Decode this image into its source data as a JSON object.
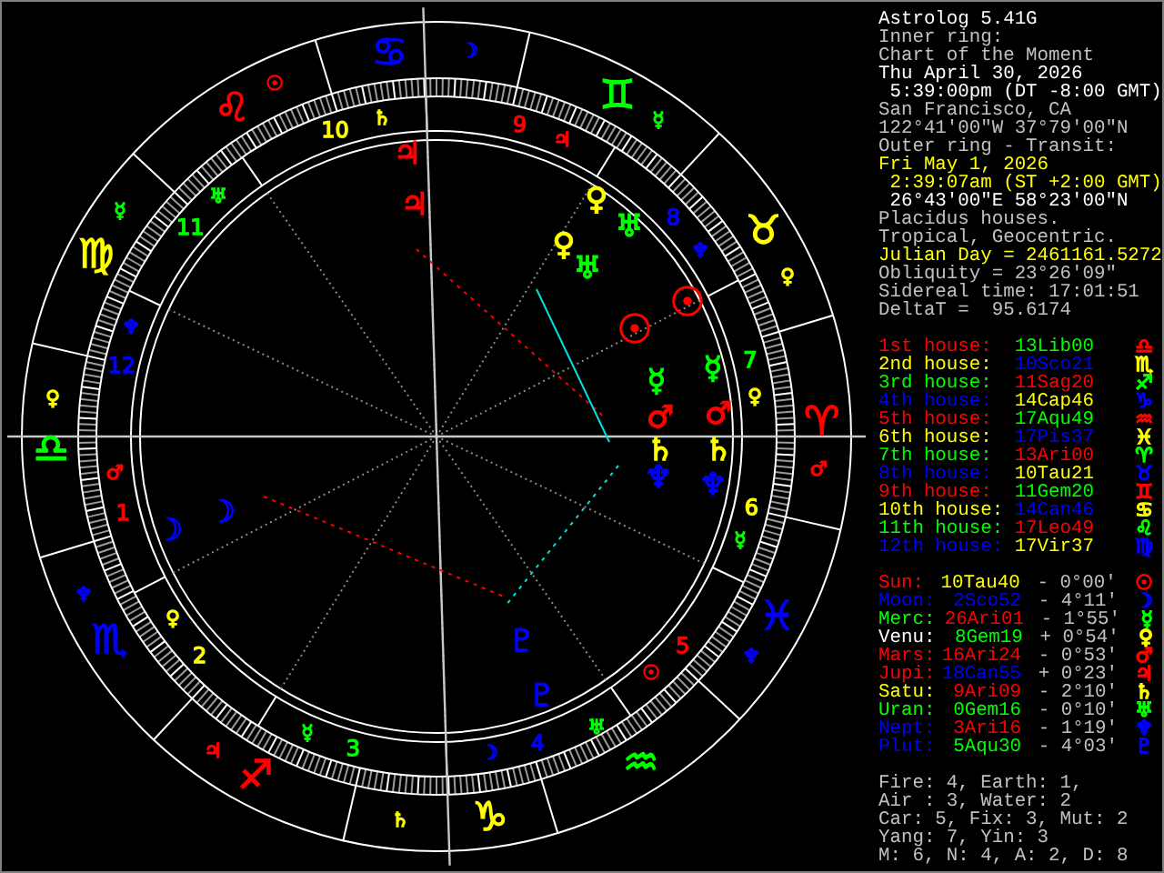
{
  "chart": {
    "signs": [
      {
        "glyph": "♈",
        "color": "#ff0000"
      },
      {
        "glyph": "♉",
        "color": "#ffff00"
      },
      {
        "glyph": "♊",
        "color": "#00ff00"
      },
      {
        "glyph": "♋",
        "color": "#0000ff"
      },
      {
        "glyph": "♌",
        "color": "#ff0000"
      },
      {
        "glyph": "♍",
        "color": "#ffff00"
      },
      {
        "glyph": "♎",
        "color": "#00ff00"
      },
      {
        "glyph": "♏",
        "color": "#0000ff"
      },
      {
        "glyph": "♐",
        "color": "#ff0000"
      },
      {
        "glyph": "♑",
        "color": "#ffff00"
      },
      {
        "glyph": "♒",
        "color": "#00ff00"
      },
      {
        "glyph": "♓",
        "color": "#0000ff"
      }
    ],
    "house_numbers": [
      {
        "text": "1",
        "color": "#ff0000"
      },
      {
        "text": "2",
        "color": "#ffff00"
      },
      {
        "text": "3",
        "color": "#00ff00"
      },
      {
        "text": "4",
        "color": "#0000ff"
      },
      {
        "text": "5",
        "color": "#ff0000"
      },
      {
        "text": "6",
        "color": "#ffff00"
      },
      {
        "text": "7",
        "color": "#00ff00"
      },
      {
        "text": "8",
        "color": "#0000ff"
      },
      {
        "text": "9",
        "color": "#ff0000"
      },
      {
        "text": "10",
        "color": "#ffff00"
      },
      {
        "text": "11",
        "color": "#00ff00"
      },
      {
        "text": "12",
        "color": "#0000ff"
      }
    ],
    "inner_planets": [
      {
        "glyph": "♃",
        "color": "#ff0000"
      },
      {
        "glyph": "♀",
        "color": "#ffff00"
      },
      {
        "glyph": "♅",
        "color": "#00ff00"
      },
      {
        "glyph": "☉",
        "color": "#ff0000"
      },
      {
        "glyph": "☿",
        "color": "#00ff00"
      },
      {
        "glyph": "♂",
        "color": "#ff0000"
      },
      {
        "glyph": "♄",
        "color": "#ffff00"
      },
      {
        "glyph": "♆",
        "color": "#0000ff"
      },
      {
        "glyph": "☽",
        "color": "#0000ff"
      },
      {
        "glyph": "♇",
        "color": "#0000ff"
      }
    ],
    "outer_planets": [
      {
        "glyph": "♃",
        "color": "#ff0000"
      },
      {
        "glyph": "♀",
        "color": "#ffff00"
      },
      {
        "glyph": "♅",
        "color": "#00ff00"
      },
      {
        "glyph": "☉",
        "color": "#ff0000"
      },
      {
        "glyph": "☿",
        "color": "#00ff00"
      },
      {
        "glyph": "♂",
        "color": "#ff0000"
      },
      {
        "glyph": "♄",
        "color": "#ffff00"
      },
      {
        "glyph": "♆",
        "color": "#0000ff"
      },
      {
        "glyph": "☽",
        "color": "#0000ff"
      },
      {
        "glyph": "♇",
        "color": "#0000ff"
      }
    ],
    "ring_glyphs": [
      {
        "glyph": "☽",
        "color": "#0000ff"
      },
      {
        "glyph": "☉",
        "color": "#ff0000"
      },
      {
        "glyph": "♄",
        "color": "#ffff00"
      },
      {
        "glyph": "☿",
        "color": "#00ff00"
      },
      {
        "glyph": "♃",
        "color": "#ff0000"
      },
      {
        "glyph": "♅",
        "color": "#00ff00"
      },
      {
        "glyph": "☿",
        "color": "#00ff00"
      },
      {
        "glyph": "♆",
        "color": "#0000ff"
      },
      {
        "glyph": "♀",
        "color": "#ffff00"
      },
      {
        "glyph": "♆",
        "color": "#0000ff"
      },
      {
        "glyph": "♀",
        "color": "#ffff00"
      },
      {
        "glyph": "♀",
        "color": "#ffff00"
      },
      {
        "glyph": "♂",
        "color": "#ff0000"
      },
      {
        "glyph": "♂",
        "color": "#ff0000"
      },
      {
        "glyph": "☿",
        "color": "#00ff00"
      },
      {
        "glyph": "♆",
        "color": "#0000ff"
      },
      {
        "glyph": "♀",
        "color": "#ffff00"
      },
      {
        "glyph": "♆",
        "color": "#0000ff"
      },
      {
        "glyph": "☉",
        "color": "#ff0000"
      },
      {
        "glyph": "☿",
        "color": "#00ff00"
      },
      {
        "glyph": "♅",
        "color": "#00ff00"
      },
      {
        "glyph": "♃",
        "color": "#ff0000"
      },
      {
        "glyph": "☽",
        "color": "#0000ff"
      },
      {
        "glyph": "♄",
        "color": "#ffff00"
      }
    ]
  },
  "info_lines": [
    {
      "text": "Astrolog 5.41G",
      "color": "#ffffff"
    },
    {
      "text": "Inner ring:",
      "color": "#c0c0c0"
    },
    {
      "text": "Chart of the Moment",
      "color": "#c0c0c0"
    },
    {
      "text": "Thu April 30, 2026",
      "color": "#ffffff"
    },
    {
      "text": " 5:39:00pm (DT -8:00 GMT)",
      "color": "#ffffff"
    },
    {
      "text": "San Francisco, CA",
      "color": "#c0c0c0"
    },
    {
      "text": "122°41'00\"W 37°79'00\"N",
      "color": "#c0c0c0"
    },
    {
      "text": "Outer ring - Transit:",
      "color": "#c0c0c0"
    },
    {
      "text": "Fri May 1, 2026",
      "color": "#ffff00"
    },
    {
      "text": " 2:39:07am (ST +2:00 GMT)",
      "color": "#ffff00"
    },
    {
      "text": " 26°43'00\"E 58°23'00\"N",
      "color": "#ffffff"
    },
    {
      "text": "Placidus houses.",
      "color": "#c0c0c0"
    },
    {
      "text": "Tropical, Geocentric.",
      "color": "#c0c0c0"
    },
    {
      "text": "Julian Day = 2461161.5272",
      "color": "#ffff00"
    },
    {
      "text": "Obliquity = 23°26'09\"",
      "color": "#c0c0c0"
    },
    {
      "text": "Sidereal time: 17:01:51",
      "color": "#c0c0c0"
    },
    {
      "text": "DeltaT =  95.6174",
      "color": "#c0c0c0"
    }
  ],
  "houses": [
    {
      "label": {
        "text": "1st house:",
        "color": "#ff0000"
      },
      "position": {
        "text": "13Lib00",
        "color": "#00ff00"
      },
      "glyph": {
        "text": "♎",
        "color": "#ff0000"
      }
    },
    {
      "label": {
        "text": "2nd house:",
        "color": "#ffff00"
      },
      "position": {
        "text": "10Sco21",
        "color": "#0000ff"
      },
      "glyph": {
        "text": "♏",
        "color": "#ffff00"
      }
    },
    {
      "label": {
        "text": "3rd house:",
        "color": "#00ff00"
      },
      "position": {
        "text": "11Sag20",
        "color": "#ff0000"
      },
      "glyph": {
        "text": "♐",
        "color": "#00ff00"
      }
    },
    {
      "label": {
        "text": "4th house:",
        "color": "#0000ff"
      },
      "position": {
        "text": "14Cap46",
        "color": "#ffff00"
      },
      "glyph": {
        "text": "♑",
        "color": "#0000ff"
      }
    },
    {
      "label": {
        "text": "5th house:",
        "color": "#ff0000"
      },
      "position": {
        "text": "17Aqu49",
        "color": "#00ff00"
      },
      "glyph": {
        "text": "♒",
        "color": "#ff0000"
      }
    },
    {
      "label": {
        "text": "6th house:",
        "color": "#ffff00"
      },
      "position": {
        "text": "17Pis37",
        "color": "#0000ff"
      },
      "glyph": {
        "text": "♓",
        "color": "#ffff00"
      }
    },
    {
      "label": {
        "text": "7th house:",
        "color": "#00ff00"
      },
      "position": {
        "text": "13Ari00",
        "color": "#ff0000"
      },
      "glyph": {
        "text": "♈",
        "color": "#00ff00"
      }
    },
    {
      "label": {
        "text": "8th house:",
        "color": "#0000ff"
      },
      "position": {
        "text": "10Tau21",
        "color": "#ffff00"
      },
      "glyph": {
        "text": "♉",
        "color": "#0000ff"
      }
    },
    {
      "label": {
        "text": "9th house:",
        "color": "#ff0000"
      },
      "position": {
        "text": "11Gem20",
        "color": "#00ff00"
      },
      "glyph": {
        "text": "♊",
        "color": "#ff0000"
      }
    },
    {
      "label": {
        "text": "10th house:",
        "color": "#ffff00"
      },
      "position": {
        "text": "14Can46",
        "color": "#0000ff"
      },
      "glyph": {
        "text": "♋",
        "color": "#ffff00"
      }
    },
    {
      "label": {
        "text": "11th house:",
        "color": "#00ff00"
      },
      "position": {
        "text": "17Leo49",
        "color": "#ff0000"
      },
      "glyph": {
        "text": "♌",
        "color": "#00ff00"
      }
    },
    {
      "label": {
        "text": "12th house:",
        "color": "#0000ff"
      },
      "position": {
        "text": "17Vir37",
        "color": "#ffff00"
      },
      "glyph": {
        "text": "♍",
        "color": "#0000ff"
      }
    }
  ],
  "planets": [
    {
      "label": {
        "text": "Sun:",
        "color": "#ff0000"
      },
      "position": {
        "text": "10Tau40",
        "color": "#ffff00"
      },
      "aspect": "- 0°00'",
      "glyph": {
        "text": "☉",
        "color": "#ff0000"
      }
    },
    {
      "label": {
        "text": "Moon:",
        "color": "#0000ff"
      },
      "position": {
        "text": "2Sco52",
        "color": "#0000ff"
      },
      "aspect": "- 4°11'",
      "glyph": {
        "text": "☽",
        "color": "#0000ff"
      }
    },
    {
      "label": {
        "text": "Merc:",
        "color": "#00ff00"
      },
      "position": {
        "text": "26Ari01",
        "color": "#ff0000"
      },
      "aspect": "- 1°55'",
      "glyph": {
        "text": "☿",
        "color": "#00ff00"
      }
    },
    {
      "label": {
        "text": "Venu:",
        "color": "#ffffff"
      },
      "position": {
        "text": "8Gem19",
        "color": "#00ff00"
      },
      "aspect": "+ 0°54'",
      "glyph": {
        "text": "♀",
        "color": "#ffff00"
      }
    },
    {
      "label": {
        "text": "Mars:",
        "color": "#ff0000"
      },
      "position": {
        "text": "16Ari24",
        "color": "#ff0000"
      },
      "aspect": "- 0°53'",
      "glyph": {
        "text": "♂",
        "color": "#ff0000"
      }
    },
    {
      "label": {
        "text": "Jupi:",
        "color": "#ff0000"
      },
      "position": {
        "text": "18Can55",
        "color": "#0000ff"
      },
      "aspect": "+ 0°23'",
      "glyph": {
        "text": "♃",
        "color": "#ff0000"
      }
    },
    {
      "label": {
        "text": "Satu:",
        "color": "#ffff00"
      },
      "position": {
        "text": "9Ari09",
        "color": "#ff0000"
      },
      "aspect": "- 2°10'",
      "glyph": {
        "text": "♄",
        "color": "#ffff00"
      }
    },
    {
      "label": {
        "text": "Uran:",
        "color": "#00ff00"
      },
      "position": {
        "text": "0Gem16",
        "color": "#00ff00"
      },
      "aspect": "- 0°10'",
      "glyph": {
        "text": "♅",
        "color": "#00ff00"
      }
    },
    {
      "label": {
        "text": "Nept:",
        "color": "#0000ff"
      },
      "position": {
        "text": "3Ari16",
        "color": "#ff0000"
      },
      "aspect": "- 1°19'",
      "glyph": {
        "text": "♆",
        "color": "#0000ff"
      }
    },
    {
      "label": {
        "text": "Plut:",
        "color": "#0000ff"
      },
      "position": {
        "text": "5Aqu30",
        "color": "#00ff00"
      },
      "aspect": "- 4°03'",
      "glyph": {
        "text": "♇",
        "color": "#0000ff"
      }
    }
  ],
  "element_lines": [
    "Fire: 4, Earth: 1,",
    "Air : 3, Water: 2",
    "Car: 5, Fix: 3, Mut: 2",
    "Yang: 7, Yin: 3",
    "M: 6, N: 4, A: 2, D: 8"
  ]
}
